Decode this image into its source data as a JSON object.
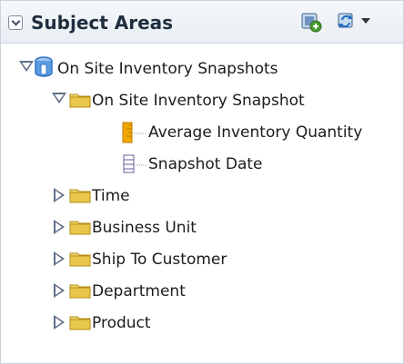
{
  "panel": {
    "title": "Subject Areas",
    "icons": [
      "add-subject-area-icon",
      "refresh-icon",
      "chevron-down-icon"
    ]
  },
  "tree": {
    "root": {
      "label": "On Site Inventory Snapshots",
      "icon": "subject-area-cube-icon",
      "expanded": true
    },
    "folder_expanded": {
      "label": "On Site Inventory Snapshot",
      "icon": "folder-icon",
      "expanded": true
    },
    "children": [
      {
        "label": "Average Inventory Quantity",
        "icon": "measure-ruler-icon"
      },
      {
        "label": "Snapshot Date",
        "icon": "attribute-column-icon"
      }
    ],
    "folders": [
      {
        "label": "Time",
        "expanded": false
      },
      {
        "label": "Business Unit",
        "expanded": false
      },
      {
        "label": "Ship To Customer",
        "expanded": false
      },
      {
        "label": "Department",
        "expanded": false
      },
      {
        "label": "Product",
        "expanded": false
      }
    ]
  },
  "colors": {
    "header_bg": "#eef2f6",
    "folder": "#e8c84a",
    "cube": "#2f74c9",
    "ruler": "#f2a800"
  }
}
